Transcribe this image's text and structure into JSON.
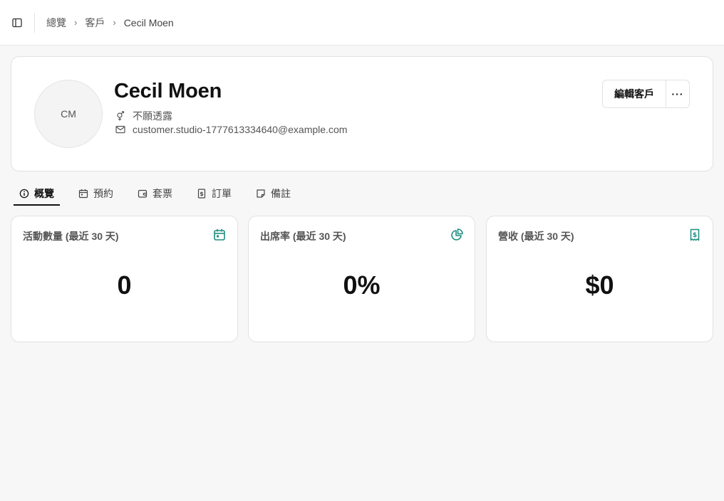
{
  "breadcrumb": {
    "items": [
      "總覽",
      "客戶",
      "Cecil Moen"
    ]
  },
  "customer": {
    "initials": "CM",
    "name": "Cecil Moen",
    "gender": "不願透露",
    "email": "customer.studio-1777613334640@example.com"
  },
  "actions": {
    "edit_label": "編輯客戶",
    "more_label": "···"
  },
  "tabs": [
    {
      "label": "概覽",
      "icon": "info-icon"
    },
    {
      "label": "預約",
      "icon": "calendar-icon"
    },
    {
      "label": "套票",
      "icon": "wallet-icon"
    },
    {
      "label": "訂單",
      "icon": "receipt-icon"
    },
    {
      "label": "備註",
      "icon": "note-icon"
    }
  ],
  "stats": [
    {
      "title": "活動數量 (最近 30 天)",
      "value": "0",
      "icon": "calendar-icon"
    },
    {
      "title": "出席率 (最近 30 天)",
      "value": "0%",
      "icon": "pie-chart-icon"
    },
    {
      "title": "營收 (最近 30 天)",
      "value": "$0",
      "icon": "receipt-icon"
    }
  ],
  "colors": {
    "accent": "#1e8e7e",
    "text": "#111111",
    "muted": "#555555",
    "border": "#e2e2e2",
    "background": "#f7f7f7"
  }
}
